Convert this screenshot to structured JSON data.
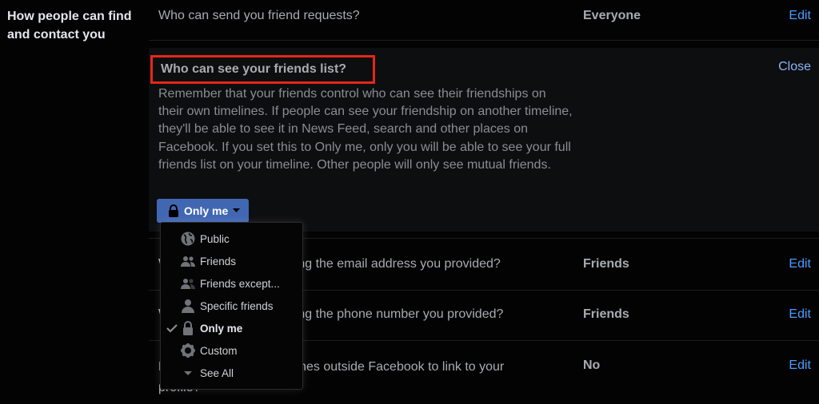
{
  "section": {
    "title": "How people can find and contact you"
  },
  "rows": [
    {
      "question": "Who can send you friend requests?",
      "value": "Everyone",
      "action": "Edit"
    },
    {
      "question": "Who can look you up using the email address you provided?",
      "value": "Friends",
      "action": "Edit"
    },
    {
      "question": "Who can look you up using the phone number you provided?",
      "value": "Friends",
      "action": "Edit"
    },
    {
      "question": "Do you want search engines outside Facebook to link to your profile?",
      "value": "No",
      "action": "Edit"
    }
  ],
  "expanded": {
    "title": "Who can see your friends list?",
    "close": "Close",
    "description": "Remember that your friends control who can see their friendships on their own timelines. If people can see your friendship on another timeline, they'll be able to see it in News Feed, search and other places on Facebook. If you set this to Only me, only you will be able to see your full friends list on your timeline. Other people will only see mutual friends.",
    "privacy_button": "Only me"
  },
  "menu": {
    "items": [
      {
        "label": "Public",
        "icon": "globe-icon"
      },
      {
        "label": "Friends",
        "icon": "friends-icon"
      },
      {
        "label": "Friends except...",
        "icon": "friends-except-icon"
      },
      {
        "label": "Specific friends",
        "icon": "person-icon"
      },
      {
        "label": "Only me",
        "icon": "lock-icon",
        "selected": true
      },
      {
        "label": "Custom",
        "icon": "gear-icon"
      },
      {
        "label": "See All",
        "icon": "caret-down-icon"
      }
    ]
  },
  "colors": {
    "accent_link": "#4a9cff",
    "button": "#4267b2",
    "highlight_box": "#e5261a"
  }
}
